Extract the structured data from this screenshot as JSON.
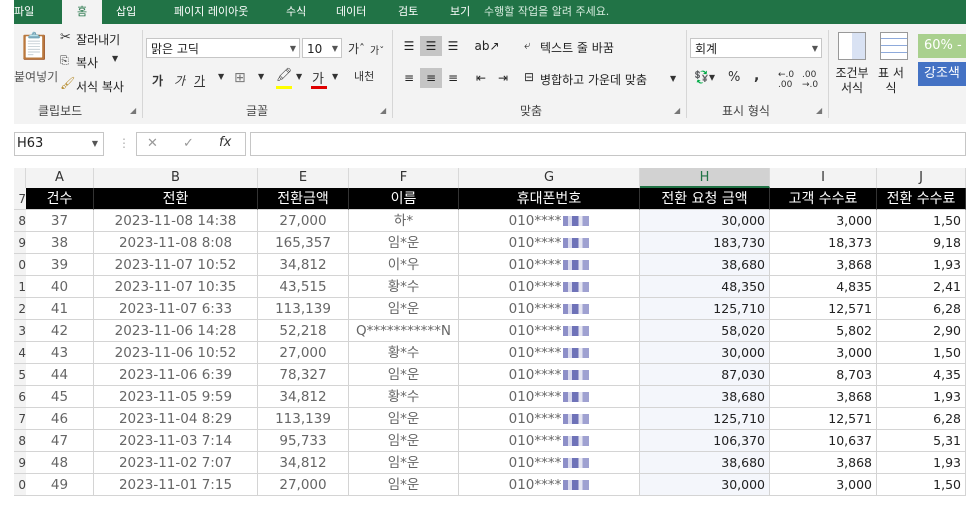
{
  "ribbon_tabs": [
    "파일",
    "홈",
    "삽입",
    "페이지 레이아웃",
    "수식",
    "데이터",
    "검토",
    "보기"
  ],
  "tell_me": "수행할 작업을 알려 주세요.",
  "clipboard": {
    "paste": "붙여넣기",
    "cut": "잘라내기",
    "copy": "복사",
    "format_painter": "서식 복사",
    "group": "클립보드"
  },
  "font": {
    "name": "맑은 고딕",
    "size": "10",
    "group": "글꼴",
    "bold": "가",
    "italic": "가",
    "underline": "가"
  },
  "alignment": {
    "wrap": "텍스트 줄 바꿈",
    "merge": "병합하고 가운데 맞춤",
    "group": "맞춤"
  },
  "number": {
    "format": "회계",
    "group": "표시 형식"
  },
  "styles": {
    "conditional": "조건부 서식",
    "table": "표 서식",
    "style1": "60% - ",
    "style2": "강조색"
  },
  "name_box": "H63",
  "columns": [
    "A",
    "B",
    "E",
    "F",
    "G",
    "H",
    "I",
    "J"
  ],
  "selected_column": "H",
  "headers": [
    "건수",
    "전환",
    "전환금액",
    "이름",
    "휴대폰번호",
    "전환 요청 금액",
    "고객 수수료",
    "전환 수수료"
  ],
  "rows": [
    {
      "n": "8",
      "a": "37",
      "b": "2023-11-08 14:38",
      "e": "27,000",
      "f": "하*",
      "g": "010****",
      "h": "30,000",
      "i": "3,000",
      "j": "1,50"
    },
    {
      "n": "9",
      "a": "38",
      "b": "2023-11-08 8:08",
      "e": "165,357",
      "f": "임*운",
      "g": "010****",
      "h": "183,730",
      "i": "18,373",
      "j": "9,18"
    },
    {
      "n": "0",
      "a": "39",
      "b": "2023-11-07 10:52",
      "e": "34,812",
      "f": "이*우",
      "g": "010****",
      "h": "38,680",
      "i": "3,868",
      "j": "1,93"
    },
    {
      "n": "1",
      "a": "40",
      "b": "2023-11-07 10:35",
      "e": "43,515",
      "f": "황*수",
      "g": "010****",
      "h": "48,350",
      "i": "4,835",
      "j": "2,41"
    },
    {
      "n": "2",
      "a": "41",
      "b": "2023-11-07 6:33",
      "e": "113,139",
      "f": "임*운",
      "g": "010****",
      "h": "125,710",
      "i": "12,571",
      "j": "6,28"
    },
    {
      "n": "3",
      "a": "42",
      "b": "2023-11-06 14:28",
      "e": "52,218",
      "f": "Q***********N",
      "g": "010****",
      "h": "58,020",
      "i": "5,802",
      "j": "2,90"
    },
    {
      "n": "4",
      "a": "43",
      "b": "2023-11-06 10:52",
      "e": "27,000",
      "f": "황*수",
      "g": "010****",
      "h": "30,000",
      "i": "3,000",
      "j": "1,50"
    },
    {
      "n": "5",
      "a": "44",
      "b": "2023-11-06 6:39",
      "e": "78,327",
      "f": "임*운",
      "g": "010****",
      "h": "87,030",
      "i": "8,703",
      "j": "4,35"
    },
    {
      "n": "6",
      "a": "45",
      "b": "2023-11-05 9:59",
      "e": "34,812",
      "f": "황*수",
      "g": "010****",
      "h": "38,680",
      "i": "3,868",
      "j": "1,93"
    },
    {
      "n": "7",
      "a": "46",
      "b": "2023-11-04 8:29",
      "e": "113,139",
      "f": "임*운",
      "g": "010****",
      "h": "125,710",
      "i": "12,571",
      "j": "6,28"
    },
    {
      "n": "8",
      "a": "47",
      "b": "2023-11-03 7:14",
      "e": "95,733",
      "f": "임*운",
      "g": "010****",
      "h": "106,370",
      "i": "10,637",
      "j": "5,31"
    },
    {
      "n": "9",
      "a": "48",
      "b": "2023-11-02 7:07",
      "e": "34,812",
      "f": "임*운",
      "g": "010****",
      "h": "38,680",
      "i": "3,868",
      "j": "1,93"
    },
    {
      "n": "0",
      "a": "49",
      "b": "2023-11-01 7:15",
      "e": "27,000",
      "f": "임*운",
      "g": "010****",
      "h": "30,000",
      "i": "3,000",
      "j": "1,50"
    }
  ],
  "colors": {
    "excel_green": "#217346",
    "header_black": "#000000"
  }
}
